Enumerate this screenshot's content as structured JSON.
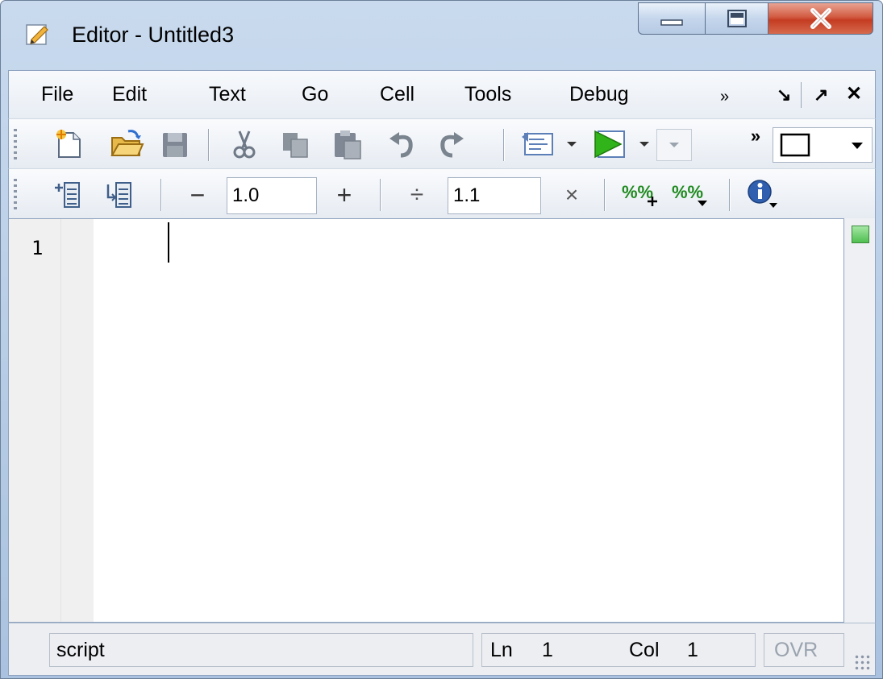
{
  "window": {
    "title": "Editor - Untitled3",
    "controls": [
      "minimize-icon",
      "maximize-icon",
      "close-icon"
    ]
  },
  "menu": {
    "items": [
      "File",
      "Edit",
      "Text",
      "Go",
      "Cell",
      "Tools",
      "Debug"
    ],
    "overflow": "»",
    "undock_glyph": "↘",
    "dock_glyph": "↗",
    "close_glyph": "✕"
  },
  "toolbar1": {
    "icons": [
      "new-file-icon",
      "open-folder-icon",
      "save-icon",
      "cut-icon",
      "copy-icon",
      "paste-icon",
      "undo-icon",
      "redo-icon",
      "publish-icon",
      "run-icon",
      "stack-dropdown",
      "overflow-icon",
      "layout-icon"
    ]
  },
  "toolbar2": {
    "cell_minus": "−",
    "cell_value_1": "1.0",
    "cell_plus": "+",
    "cell_divide": "÷",
    "cell_value_2": "1.1",
    "cell_times": "×"
  },
  "editor": {
    "lines": [
      "1"
    ],
    "content": ""
  },
  "status": {
    "mode": "script",
    "ln_label": "Ln",
    "ln_value": "1",
    "col_label": "Col",
    "col_value": "1",
    "ovr": "OVR"
  },
  "colors": {
    "frame": "#b5cbe5",
    "close_button": "#c43c22",
    "indicator": "#4fc04f"
  }
}
